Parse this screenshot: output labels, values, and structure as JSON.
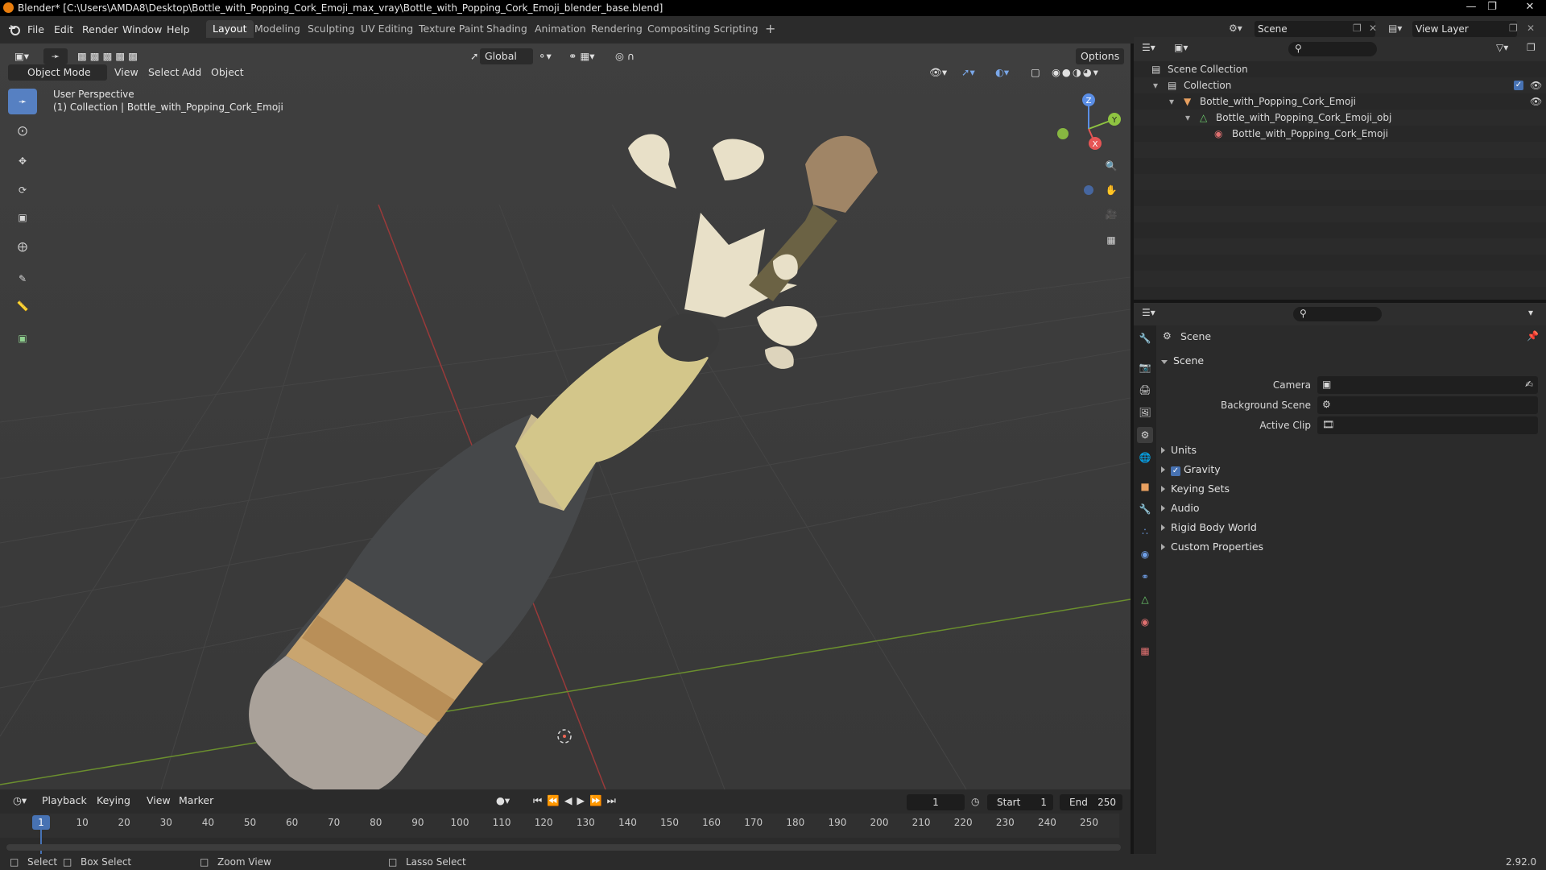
{
  "window": {
    "title": "Blender* [C:\\Users\\AMDA8\\Desktop\\Bottle_with_Popping_Cork_Emoji_max_vray\\Bottle_with_Popping_Cork_Emoji_blender_base.blend]"
  },
  "menu": [
    "File",
    "Edit",
    "Render",
    "Window",
    "Help"
  ],
  "workspaces": [
    "Layout",
    "Modeling",
    "Sculpting",
    "UV Editing",
    "Texture Paint",
    "Shading",
    "Animation",
    "Rendering",
    "Compositing",
    "Scripting"
  ],
  "active_workspace": "Layout",
  "scene_selector": {
    "value": "Scene"
  },
  "view_layer_selector": {
    "value": "View Layer"
  },
  "viewport": {
    "mode": "Object Mode",
    "menus": [
      "View",
      "Select",
      "Add",
      "Object"
    ],
    "orientation": "Global",
    "options_label": "Options",
    "overlay_title": "User Perspective",
    "overlay_subtitle": "(1) Collection | Bottle_with_Popping_Cork_Emoji",
    "gizmo": {
      "x": "X",
      "y": "Y",
      "z": "Z"
    }
  },
  "outliner": {
    "rows": [
      {
        "label": "Scene Collection",
        "indent": 0
      },
      {
        "label": "Collection",
        "indent": 1
      },
      {
        "label": "Bottle_with_Popping_Cork_Emoji",
        "indent": 2
      },
      {
        "label": "Bottle_with_Popping_Cork_Emoji_obj",
        "indent": 3
      },
      {
        "label": "Bottle_with_Popping_Cork_Emoji",
        "indent": 4
      }
    ]
  },
  "properties": {
    "context": "Scene",
    "panel": "Scene",
    "fields": [
      {
        "label": "Camera",
        "value": ""
      },
      {
        "label": "Background Scene",
        "value": ""
      },
      {
        "label": "Active Clip",
        "value": ""
      }
    ],
    "subpanels": [
      "Units",
      "Gravity",
      "Keying Sets",
      "Audio",
      "Rigid Body World",
      "Custom Properties"
    ],
    "gravity_enabled": true
  },
  "timeline": {
    "menus": [
      "Playback",
      "Keying",
      "View",
      "Marker"
    ],
    "current_frame": "1",
    "start_label": "Start",
    "start_value": "1",
    "end_label": "End",
    "end_value": "250",
    "ticks": [
      "10",
      "20",
      "30",
      "40",
      "50",
      "60",
      "70",
      "80",
      "90",
      "100",
      "110",
      "120",
      "130",
      "140",
      "150",
      "160",
      "170",
      "180",
      "190",
      "200",
      "210",
      "220",
      "230",
      "240",
      "250"
    ],
    "playhead": "1"
  },
  "statusbar": {
    "items": [
      "Select",
      "Box Select",
      "Zoom View",
      "Lasso Select"
    ],
    "version": "2.92.0"
  },
  "colors": {
    "accent": "#4772b3",
    "bottle_dark": "#46484a",
    "bottle_label": "#c9a56f",
    "foil": "#d6c98a",
    "cork": "#a08566",
    "foam": "#e8e0c8"
  }
}
